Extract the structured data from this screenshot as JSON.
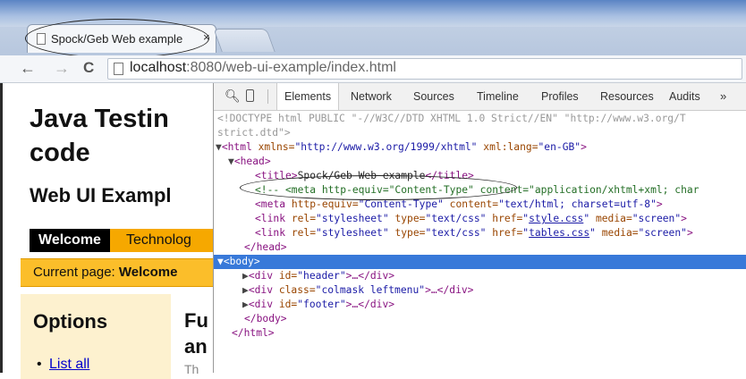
{
  "browser": {
    "tab_title": "Spock/Geb Web example",
    "tab_close": "×",
    "nav": {
      "back": "←",
      "forward": "→",
      "reload": "C"
    },
    "url": {
      "host": "localhost",
      "rest": ":8080/web-ui-example/index.html"
    }
  },
  "page": {
    "title_line1": "Java Testin",
    "title_line2": "code",
    "subtitle": "Web UI Exampl",
    "menu": {
      "welcome": "Welcome",
      "technology": "Technolog"
    },
    "current_label": "Current page: ",
    "current_value": "Welcome",
    "options_title": "Options",
    "list_bullet": "•",
    "list_all": "List all",
    "content_fu": "Fu",
    "content_an": "an",
    "content_th": "Th"
  },
  "devtools": {
    "tabs": [
      "Elements",
      "Network",
      "Sources",
      "Timeline",
      "Profiles",
      "Resources",
      "Audits"
    ],
    "more": "»",
    "lines": {
      "doctype1": "<!DOCTYPE html PUBLIC \"-//W3C//DTD XHTML 1.0 Strict//EN\" \"http://www.w3.org/T",
      "doctype2": "strict.dtd\">",
      "html_open_tag": "<html",
      "html_xmlns_attr": " xmlns=",
      "html_xmlns_val": "\"http://www.w3.org/1999/xhtml\"",
      "html_lang_attr": " xml:lang=",
      "html_lang_val": "\"en-GB\"",
      "html_close_bracket": ">",
      "head_open": "<head>",
      "title_open": "<title>",
      "title_text": "Spock/Geb Web example",
      "title_close": "</title>",
      "comment": "<!-- <meta http-equiv=\"Content-Type\" content=\"application/xhtml+xml; char",
      "meta_tag": "<meta",
      "meta_attr1": " http-equiv=",
      "meta_val1": "\"Content-Type\"",
      "meta_attr2": " content=",
      "meta_val2": "\"text/html; charset=utf-8\"",
      "link_tag": "<link",
      "link_rel_attr": " rel=",
      "link_rel_val": "\"stylesheet\"",
      "link_type_attr": " type=",
      "link_type_val": "\"text/css\"",
      "link_href_attr": " href=",
      "q": "\"",
      "style_css": "style.css",
      "tables_css": "tables.css",
      "link_media_attr": " media=",
      "link_media_val": "\"screen\"",
      "head_close": "</head>",
      "body_open": "<body>",
      "div_header_tag": "<div",
      "id_attr": " id=",
      "header_val": "\"header\"",
      "class_attr": " class=",
      "colmask_val": "\"colmask leftmenu\"",
      "footer_val": "\"footer\"",
      "ellipsis_close": ">…</div>",
      "body_close": "</body>",
      "html_close": "</html>"
    }
  }
}
